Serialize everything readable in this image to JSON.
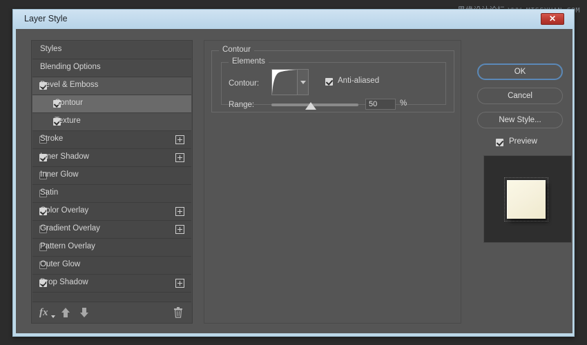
{
  "watermark": {
    "cn": "思缘设计论坛",
    "en": "WWW.MISSYUAN.COM"
  },
  "window": {
    "title": "Layer Style",
    "close_label": "✕"
  },
  "styles_list": {
    "rows": [
      {
        "label": "Styles",
        "kind": "header",
        "indent": 0,
        "checkbox": null,
        "plus": false
      },
      {
        "label": "Blending Options",
        "kind": "header",
        "indent": 0,
        "checkbox": null,
        "plus": false
      },
      {
        "label": "Bevel & Emboss",
        "kind": "parent",
        "indent": 0,
        "checkbox": true,
        "plus": false
      },
      {
        "label": "Contour",
        "kind": "selected",
        "indent": 1,
        "checkbox": true,
        "plus": false
      },
      {
        "label": "Texture",
        "kind": "sub",
        "indent": 1,
        "checkbox": true,
        "plus": false
      },
      {
        "label": "Stroke",
        "kind": "normal",
        "indent": 0,
        "checkbox": false,
        "plus": true
      },
      {
        "label": "Inner Shadow",
        "kind": "normal",
        "indent": 0,
        "checkbox": true,
        "plus": true
      },
      {
        "label": "Inner Glow",
        "kind": "normal",
        "indent": 0,
        "checkbox": false,
        "plus": false
      },
      {
        "label": "Satin",
        "kind": "normal",
        "indent": 0,
        "checkbox": false,
        "plus": false
      },
      {
        "label": "Color Overlay",
        "kind": "normal",
        "indent": 0,
        "checkbox": true,
        "plus": true
      },
      {
        "label": "Gradient Overlay",
        "kind": "normal",
        "indent": 0,
        "checkbox": false,
        "plus": true
      },
      {
        "label": "Pattern Overlay",
        "kind": "normal",
        "indent": 0,
        "checkbox": false,
        "plus": false
      },
      {
        "label": "Outer Glow",
        "kind": "normal",
        "indent": 0,
        "checkbox": false,
        "plus": false
      },
      {
        "label": "Drop Shadow",
        "kind": "normal",
        "indent": 0,
        "checkbox": true,
        "plus": true
      },
      {
        "label": "",
        "kind": "blank",
        "indent": 0,
        "checkbox": null,
        "plus": false
      }
    ],
    "toolbar": {
      "fx_label": "fx",
      "move_up_icon": "arrow-up-icon",
      "move_down_icon": "arrow-down-icon",
      "delete_icon": "trash-icon"
    }
  },
  "contour_panel": {
    "group_title": "Contour",
    "subgroup_title": "Elements",
    "contour_label": "Contour:",
    "contour_preset_icon": "contour-curve-swatch",
    "antialiased_label": "Anti-aliased",
    "antialiased_checked": true,
    "range_label": "Range:",
    "range_value": "50",
    "range_unit": "%",
    "range_percent": 45
  },
  "buttons": {
    "ok": "OK",
    "cancel": "Cancel",
    "new_style": "New Style...",
    "preview_label": "Preview",
    "preview_checked": true,
    "focus_ring_color": "#5b89b8"
  },
  "preview": {
    "swatch_color": "#f6f1dd",
    "background_color": "#2e2e2e"
  }
}
